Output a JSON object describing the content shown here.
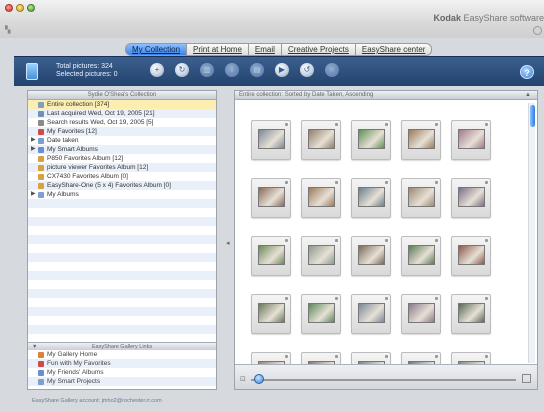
{
  "window": {
    "brand_bold": "Kodak",
    "brand_rest": " EasyShare software"
  },
  "tabs": [
    {
      "label": "My Collection",
      "active": true
    },
    {
      "label": "Print at Home",
      "active": false
    },
    {
      "label": "Email",
      "active": false
    },
    {
      "label": "Creative Projects",
      "active": false
    },
    {
      "label": "EasyShare center",
      "active": false
    }
  ],
  "toolbar": {
    "total_pictures": "Total pictures: 324",
    "selected_pictures": "Selected pictures: 0",
    "help_label": "?",
    "buttons": [
      {
        "icon": "add-icon",
        "glyph": "+",
        "dim": false
      },
      {
        "icon": "refresh-icon",
        "glyph": "↻",
        "dim": false
      },
      {
        "icon": "trash-icon",
        "glyph": "▥",
        "dim": true
      },
      {
        "icon": "info-icon",
        "glyph": "i",
        "dim": true
      },
      {
        "icon": "edit-icon",
        "glyph": "▤",
        "dim": true
      },
      {
        "icon": "slideshow-icon",
        "glyph": "▶",
        "dim": false
      },
      {
        "icon": "rotate-icon",
        "glyph": "↺",
        "dim": false
      },
      {
        "icon": "search-icon",
        "glyph": "○",
        "dim": true
      }
    ]
  },
  "collection": {
    "header": "Sydie O'Shea's Collection",
    "items": [
      {
        "label": "Entire collection [374]",
        "selected": true,
        "icon_color": "#7f9ec4",
        "expander": false
      },
      {
        "label": "Last acquired Wed, Oct 19, 2005 [21]",
        "selected": false,
        "icon_color": "#6f8eb8",
        "expander": false
      },
      {
        "label": "Search results Wed, Oct 19, 2005 [5]",
        "selected": false,
        "icon_color": "#8a8a8a",
        "expander": false
      },
      {
        "label": "My Favorites [12]",
        "selected": false,
        "icon_color": "#d04a4a",
        "expander": false
      },
      {
        "label": "Date taken",
        "selected": false,
        "icon_color": "#7a9fd0",
        "expander": true
      },
      {
        "label": "My Smart Albums",
        "selected": false,
        "icon_color": "#6a8fd1",
        "expander": true
      },
      {
        "label": "P850 Favorites Album [12]",
        "selected": false,
        "icon_color": "#d9a13c",
        "expander": false
      },
      {
        "label": "picture viewer Favorites Album [12]",
        "selected": false,
        "icon_color": "#d9a13c",
        "expander": false
      },
      {
        "label": "CX7430 Favorites Album [0]",
        "selected": false,
        "icon_color": "#d9a13c",
        "expander": false
      },
      {
        "label": "EasyShare-One (5 x 4) Favorites Album [0]",
        "selected": false,
        "icon_color": "#d9a13c",
        "expander": false
      },
      {
        "label": "My Albums",
        "selected": false,
        "icon_color": "#7a9fd0",
        "expander": true
      }
    ]
  },
  "gallery": {
    "header": "EasyShare Gallery Links",
    "items": [
      {
        "label": "My Gallery Home",
        "icon_color": "#d9823c"
      },
      {
        "label": "Fun with My Favorites",
        "icon_color": "#d04a4a"
      },
      {
        "label": "My Friends' Albums",
        "icon_color": "#6a8fd1"
      },
      {
        "label": "My Smart Projects",
        "icon_color": "#7a9fd0"
      }
    ]
  },
  "footer": {
    "account": "EasyShare Gallery account: jmho2@rochester.rr.com"
  },
  "photos_panel": {
    "header": "Entire collection: Sorted by Date Taken, Ascending",
    "thumbnails": [
      [
        "#7c8797",
        "#8f8068",
        "#5f8f57",
        "#9a7c5c",
        "#a07a8a"
      ],
      [
        "#8a6a58",
        "#9c7a5a",
        "#6b7f8d",
        "#9a8a72",
        "#7a6f8a"
      ],
      [
        "#6c8a5a",
        "#8a9a8c",
        "#7a6a5a",
        "#5c7a55",
        "#8a5a4a"
      ],
      [
        "#6a7a5a",
        "#5a8a5a",
        "#7a8a9a",
        "#8a7a8a",
        "#5a6a5a"
      ],
      [
        "#9a8a7a",
        "#8a7a6a",
        "#7a8a7a",
        "#6a7a8a",
        "#8a8a7a"
      ]
    ]
  }
}
